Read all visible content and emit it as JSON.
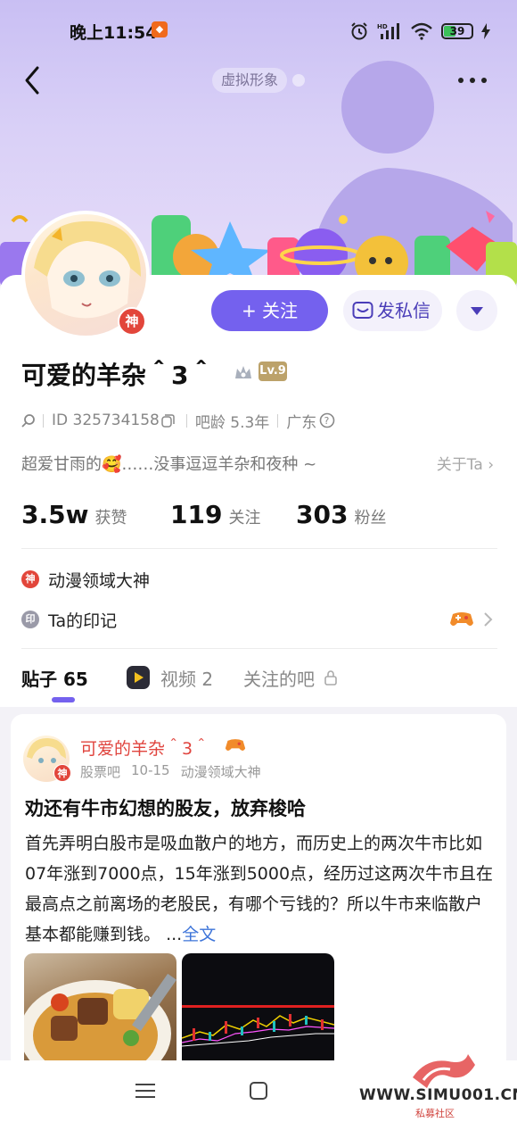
{
  "status_bar": {
    "time": "晚上11:54",
    "battery": "39"
  },
  "header": {
    "virtual_label": "虚拟形象"
  },
  "profile": {
    "username": "可爱的羊杂＾3＾",
    "god_badge": "神",
    "level": "Lv.9",
    "id_text": "ID 325734158",
    "bar_age": "吧龄 5.3年",
    "region": "广东",
    "bio": "超爱甘雨的🥰……没事逗逗羊杂和夜种 ~",
    "about_label": "关于Ta"
  },
  "actions": {
    "follow_label": "+ 关注",
    "message_label": "发私信"
  },
  "stats": [
    {
      "value": "3.5w",
      "label": "获赞"
    },
    {
      "value": "119",
      "label": "关注"
    },
    {
      "value": "303",
      "label": "粉丝"
    }
  ],
  "tags": {
    "god_domain": {
      "icon_text": "神",
      "label": "动漫领域大神"
    },
    "imprint": {
      "icon_text": "印",
      "label": "Ta的印记"
    }
  },
  "tabs": [
    {
      "label": "贴子 65"
    },
    {
      "label": "视频 2"
    },
    {
      "label": "关注的吧"
    }
  ],
  "post": {
    "author": "可爱的羊杂＾3＾",
    "bar": "股票吧",
    "date": "10-15",
    "author_tag": "动漫领域大神",
    "title": "劝还有牛市幻想的股友，放弃梭哈",
    "body": "首先弄明白股市是吸血散户的地方，而历史上的两次牛市比如07年涨到7000点，15年涨到5000点，经历过这两次牛市且在最高点之前离场的老股民，有哪个亏钱的？所以牛市来临散户基本都能赚到钱。",
    "ellipsis": "...",
    "more_label": "全文"
  },
  "watermark": {
    "site": "WWW.SIMU001.CN",
    "sub": "私募社区"
  },
  "colors": {
    "accent": "#7461ee",
    "red_badge": "#e2463b",
    "link": "#3d74d9"
  }
}
